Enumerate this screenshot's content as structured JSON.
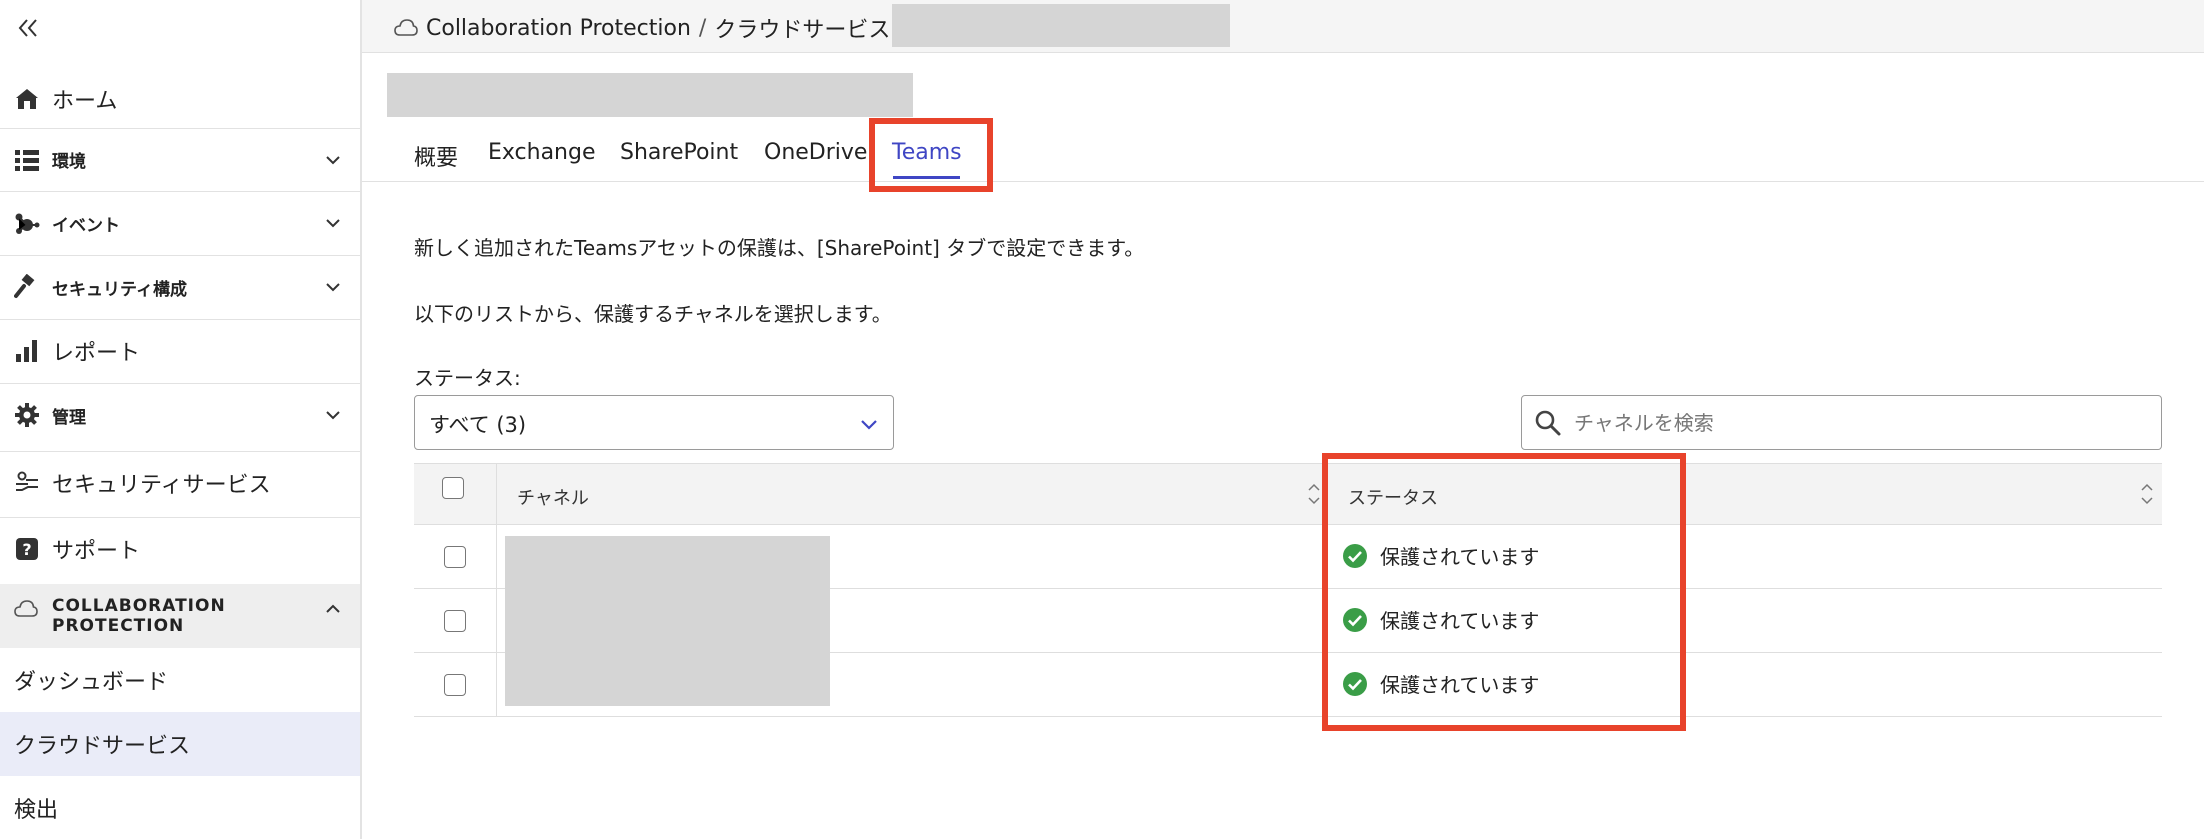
{
  "sidebar": {
    "items": [
      {
        "label": "ホーム",
        "icon": "home-icon"
      },
      {
        "label": "環境",
        "icon": "list-icon"
      },
      {
        "label": "イベント",
        "icon": "event-icon"
      },
      {
        "label": "セキュリティ構成",
        "icon": "gavel-icon"
      },
      {
        "label": "レポート",
        "icon": "bar-chart-icon"
      },
      {
        "label": "管理",
        "icon": "gear-icon"
      },
      {
        "label": "セキュリティサービス",
        "icon": "security-service-icon"
      },
      {
        "label": "サポート",
        "icon": "help-icon"
      }
    ],
    "section": {
      "line1": "COLLABORATION",
      "line2": "PROTECTION",
      "icon": "cloud-icon"
    },
    "sub_items": [
      {
        "label": "ダッシュボード"
      },
      {
        "label": "クラウドサービス"
      },
      {
        "label": "検出"
      }
    ]
  },
  "breadcrumb": {
    "root": "Collaboration Protection",
    "second": "クラウドサービス",
    "separator": "/"
  },
  "tabs": [
    {
      "label": "概要"
    },
    {
      "label": "Exchange"
    },
    {
      "label": "SharePoint"
    },
    {
      "label": "OneDrive"
    },
    {
      "label": "Teams"
    }
  ],
  "content": {
    "info1": "新しく追加されたTeamsアセットの保護は、[SharePoint] タブで設定できます。",
    "info2": "以下のリストから、保護するチャネルを選択します。",
    "status_label": "ステータス:",
    "status_filter_value": "すべて (3)",
    "search_placeholder": "チャネルを検索"
  },
  "table": {
    "columns": [
      "チャネル",
      "ステータス"
    ],
    "rows": [
      {
        "status": "保護されています"
      },
      {
        "status": "保護されています"
      },
      {
        "status": "保護されています"
      }
    ]
  },
  "colors": {
    "accent": "#3f46c4",
    "highlight": "#e8432b",
    "success": "#3a9d47",
    "active_bg": "#eaecf8"
  }
}
